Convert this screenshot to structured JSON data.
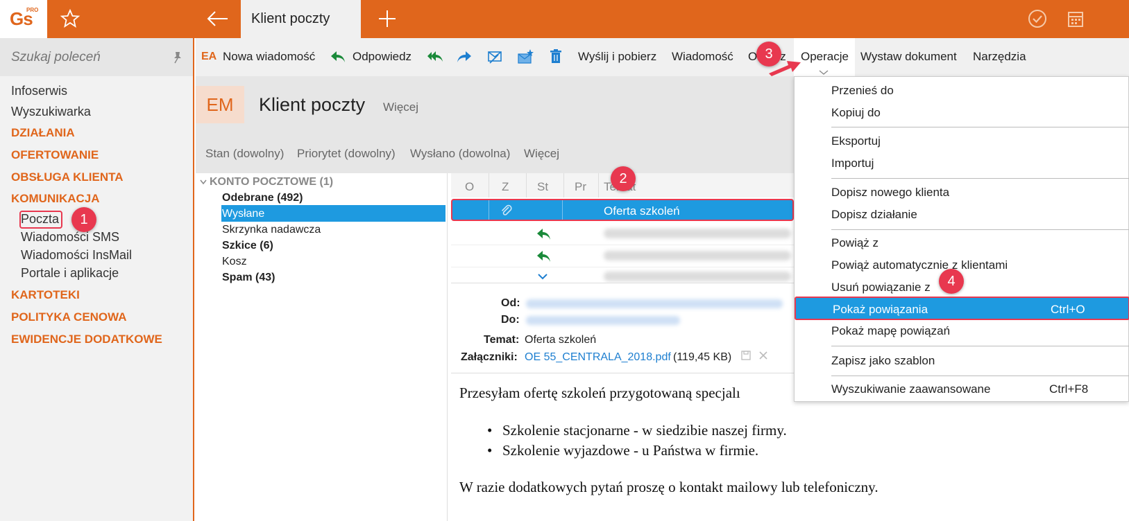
{
  "app": {
    "logo": "Gs",
    "logo_sup": "PRO",
    "active_tab": "Klient poczty"
  },
  "sidebar": {
    "search_placeholder": "Szukaj poleceń",
    "links": [
      "Infoserwis",
      "Wyszukiwarka"
    ],
    "categories": {
      "dzialania": "DZIAŁANIA",
      "ofertowanie": "OFERTOWANIE",
      "obsluga": "OBSŁUGA KLIENTA",
      "komunikacja": "KOMUNIKACJA",
      "kartoteki": "KARTOTEKI",
      "polityka": "POLITYKA CENOWA",
      "ewidencje": "EWIDENCJE DODATKOWE"
    },
    "komunikacja_items": [
      "Poczta",
      "Wiadomości SMS",
      "Wiadomości InsMail",
      "Portale i aplikacje"
    ]
  },
  "toolbar": {
    "ea": "EA",
    "new_message": "Nowa wiadomość",
    "reply": "Odpowiedz",
    "send_receive": "Wyślij i pobierz",
    "message": "Wiadomość",
    "view": "Obrócz",
    "operations": "Operacje",
    "issue_document": "Wystaw dokument",
    "tools": "Narzędzia"
  },
  "header": {
    "badge": "EM",
    "title": "Klient poczty",
    "more": "Więcej"
  },
  "filters": [
    "Stan (dowolny)",
    "Priorytet (dowolny)",
    "Wysłano (dowolna)",
    "Więcej"
  ],
  "tree": {
    "account": "KONTO POCZTOWE (1)",
    "folders": [
      "Odebrane (492)",
      "Wysłane",
      "Skrzynka nadawcza",
      "Szkice (6)",
      "Kosz",
      "Spam (43)"
    ]
  },
  "list": {
    "columns": [
      "O",
      "Z",
      "St",
      "Pr",
      "Temat"
    ],
    "selected_subject": "Oferta szkoleń"
  },
  "preview": {
    "from_label": "Od:",
    "to_label": "Do:",
    "subject_label": "Temat:",
    "subject_value": "Oferta szkoleń",
    "attachments_label": "Załączniki:",
    "attachment_name": "OE 55_CENTRALA_2018.pdf",
    "attachment_size": "(119,45 KB)",
    "body_line1": "Przesyłam ofertę szkoleń przygotowaną specjalı",
    "bullet1": "Szkolenie stacjonarne - w siedzibie naszej firmy.",
    "bullet2": "Szkolenie wyjazdowe - u Państwa w firmie.",
    "body_line2": "W razie dodatkowych pytań proszę o kontakt mailowy lub telefoniczny."
  },
  "menu": {
    "items": {
      "move": "Przenieś do",
      "copy": "Kopiuj do",
      "export": "Eksportuj",
      "import": "Importuj",
      "add_client": "Dopisz nowego klienta",
      "add_action": "Dopisz działanie",
      "link": "Powiąż z",
      "link_auto": "Powiąż automatycznie z klientami",
      "unlink": "Usuń powiązanie z",
      "show_links": "Pokaż powiązania",
      "show_links_map": "Pokaż mapę powiązań",
      "save_template": "Zapisz jako szablon",
      "adv_search": "Wyszukiwanie zaawansowane"
    },
    "shortcuts": {
      "show_links": "Ctrl+O",
      "adv_search": "Ctrl+F8"
    }
  },
  "badges": [
    "1",
    "2",
    "3",
    "4"
  ],
  "colors": {
    "brand": "#e0661c",
    "selection": "#1e9ae0",
    "callout": "#e8384f"
  }
}
